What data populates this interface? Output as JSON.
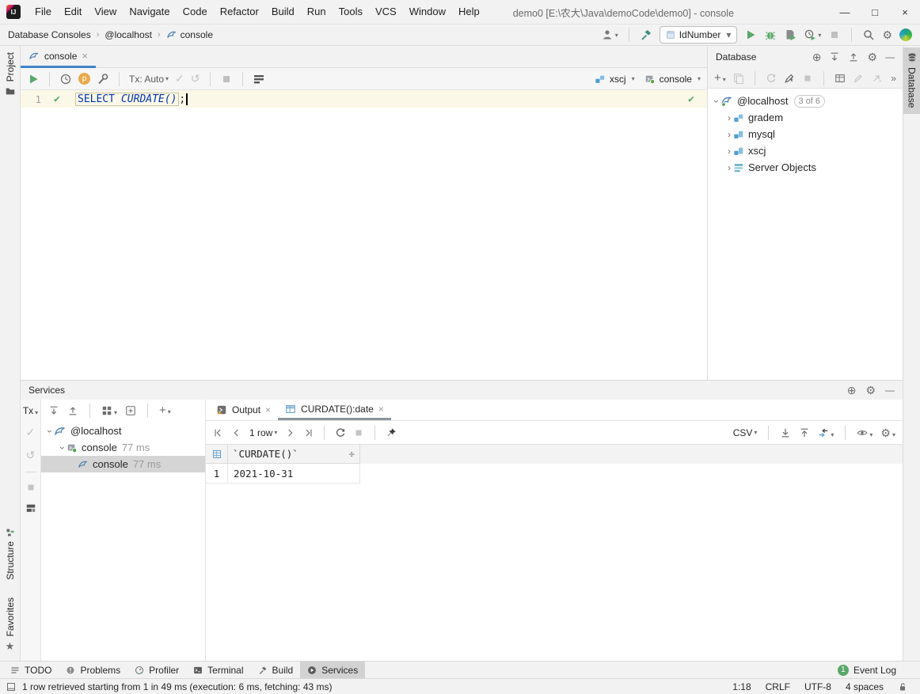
{
  "title_bar": {
    "title": "demo0 [E:\\农大\\Java\\demoCode\\demo0] - console",
    "menus": [
      "File",
      "Edit",
      "View",
      "Navigate",
      "Code",
      "Refactor",
      "Build",
      "Run",
      "Tools",
      "VCS",
      "Window",
      "Help"
    ],
    "minimize": "—",
    "maximize": "□",
    "close": "×"
  },
  "toolbar": {
    "breadcrumbs": [
      "Database Consoles",
      "@localhost",
      "console"
    ],
    "run_config": "IdNumber"
  },
  "left_stripe": {
    "project": "Project",
    "structure": "Structure",
    "favorites": "Favorites"
  },
  "right_stripe": {
    "database": "Database"
  },
  "editor": {
    "tab": "console",
    "tx_mode": "Tx: Auto",
    "schema": "xscj",
    "session": "console",
    "code": {
      "line_no": "1",
      "keyword": "SELECT",
      "function": "CURDATE()",
      "terminator": ";"
    }
  },
  "database_panel": {
    "title": "Database",
    "tree": [
      {
        "label": "@localhost",
        "badge": "3 of 6"
      },
      {
        "label": "gradem"
      },
      {
        "label": "mysql"
      },
      {
        "label": "xscj"
      },
      {
        "label": "Server Objects"
      }
    ]
  },
  "services": {
    "title": "Services",
    "tx": "Tx",
    "tree": [
      {
        "label": "@localhost",
        "time": ""
      },
      {
        "label": "console",
        "time": "77 ms"
      },
      {
        "label": "console",
        "time": "77 ms"
      }
    ],
    "tabs": [
      {
        "label": "Output"
      },
      {
        "label": "CURDATE():date"
      }
    ],
    "grid_toolbar": {
      "page": "1 row",
      "format": "CSV"
    },
    "grid": {
      "header": "`CURDATE()`",
      "rows": [
        {
          "num": "1",
          "value": "2021-10-31"
        }
      ]
    }
  },
  "bottom_bar": {
    "tabs": [
      "TODO",
      "Problems",
      "Profiler",
      "Terminal",
      "Build",
      "Services"
    ],
    "event_log": {
      "label": "Event Log",
      "badge": "1"
    }
  },
  "status_bar": {
    "message": "1 row retrieved starting from 1 in 49 ms (execution: 6 ms, fetching: 43 ms)",
    "caret": "1:18",
    "line_sep": "CRLF",
    "encoding": "UTF-8",
    "indent": "4 spaces"
  },
  "colors": {
    "accent": "#4083C9",
    "run_green": "#59A869",
    "keyword_blue": "#0033B3"
  }
}
